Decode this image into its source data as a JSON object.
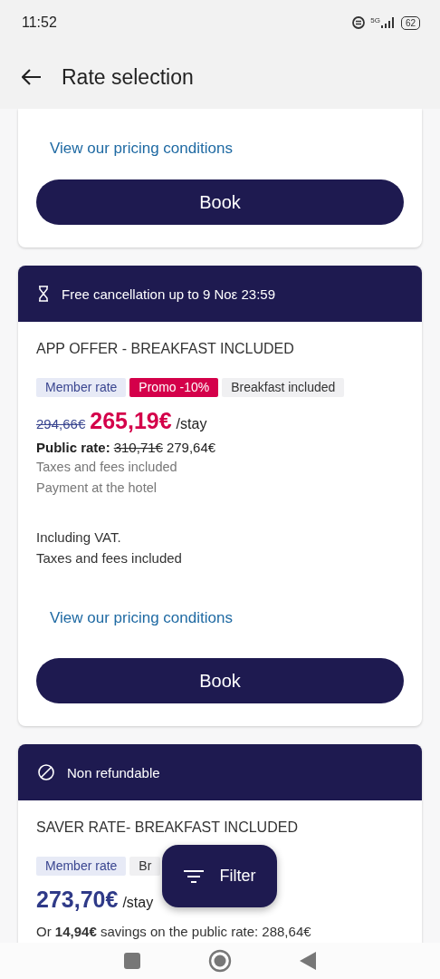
{
  "status_bar": {
    "time": "11:52",
    "network": "5G",
    "battery": "62"
  },
  "app_bar": {
    "title": "Rate selection"
  },
  "offers": [
    {
      "link": "View our pricing conditions",
      "button": "Book"
    },
    {
      "banner": {
        "kind": "cancellation",
        "text": "Free cancellation up to 9 Νοε 23:59"
      },
      "title": "APP OFFER - BREAKFAST INCLUDED",
      "tags": [
        {
          "label": "Member rate",
          "kind": "member"
        },
        {
          "label": "Promo -10%",
          "kind": "promo"
        },
        {
          "label": "Breakfast included",
          "kind": "plain"
        }
      ],
      "price": {
        "kind": "promo",
        "old": "294,66€",
        "current": "265,19€",
        "unit": "/stay"
      },
      "public_rate": {
        "label": "Public rate:",
        "old": "310,71€",
        "current": "279,64€"
      },
      "notes": [
        "Taxes and fees included",
        "Payment at the hotel"
      ],
      "extra_notes": [
        "Including VAT.",
        "Taxes and fees included"
      ],
      "link": "View our pricing conditions",
      "button": "Book"
    },
    {
      "banner": {
        "kind": "non_refundable",
        "text": "Non refundable"
      },
      "title": "SAVER RATE- BREAKFAST INCLUDED",
      "tags": [
        {
          "label": "Member rate",
          "kind": "member"
        },
        {
          "label": "Br",
          "kind": "plain"
        }
      ],
      "price": {
        "kind": "member",
        "current": "273,70€",
        "unit": "/stay"
      },
      "savings": "Or **14,94€** savings on the public rate: 288,64€"
    }
  ],
  "fab": {
    "label": "Filter"
  }
}
